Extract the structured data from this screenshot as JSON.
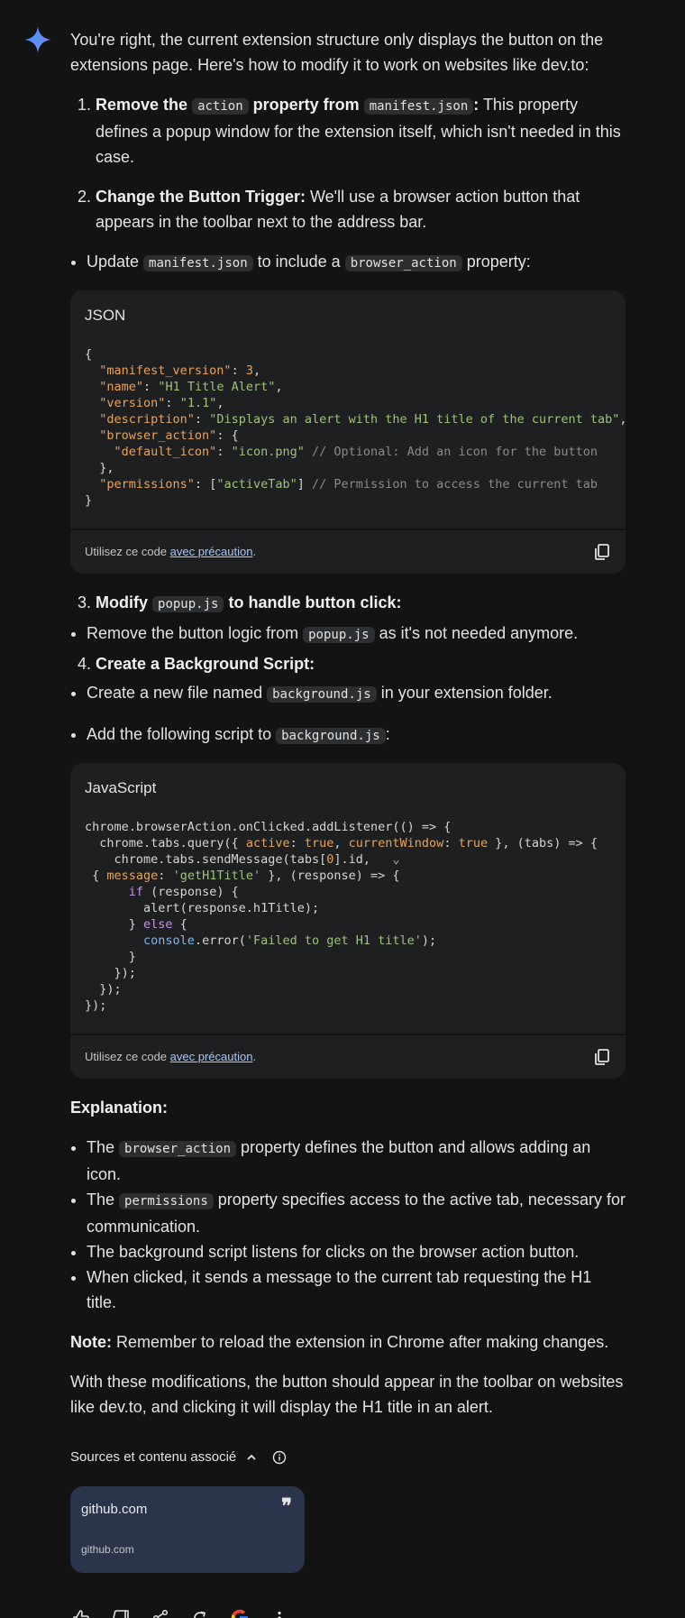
{
  "intro": "You're right, the current extension structure only displays the button on the extensions page. Here's how to modify it to work on websites like dev.to:",
  "step1": {
    "b1": "Remove the",
    "c1": "action",
    "b2": "property from",
    "c2": "manifest.json",
    "b3": ":",
    "text": " This property defines a popup window for the extension itself, which isn't needed in this case."
  },
  "step2": {
    "b": "Change the Button Trigger:",
    "text": " We'll use a browser action button that appears in the toolbar next to the address bar."
  },
  "bullet_update": {
    "t1": "Update ",
    "c1": "manifest.json",
    "t2": " to include a ",
    "c2": "browser_action",
    "t3": " property:"
  },
  "code1": {
    "lang": "JSON",
    "footer_text": "Utilisez ce code ",
    "footer_link": "avec précaution",
    "footer_end": "."
  },
  "step3": {
    "b1": "Modify",
    "c": "popup.js",
    "b2": "to handle button click:"
  },
  "bullet_remove": {
    "t1": "Remove the button logic from ",
    "c": "popup.js",
    "t2": " as it's not needed anymore."
  },
  "step4": {
    "b": "Create a Background Script:"
  },
  "bullet_create": {
    "t1": "Create a new file named ",
    "c": "background.js",
    "t2": " in your extension folder."
  },
  "bullet_add": {
    "t1": "Add the following script to ",
    "c": "background.js",
    "t2": ":"
  },
  "code2": {
    "lang": "JavaScript",
    "footer_text": "Utilisez ce code ",
    "footer_link": "avec précaution",
    "footer_end": "."
  },
  "explanation": {
    "title": "Explanation:",
    "items": [
      {
        "t1": "The ",
        "c": "browser_action",
        "t2": " property defines the button and allows adding an icon."
      },
      {
        "t1": "The ",
        "c": "permissions",
        "t2": " property specifies access to the active tab, necessary for communication."
      },
      {
        "t1": "The background script listens for clicks on the browser action button."
      },
      {
        "t1": "When clicked, it sends a message to the current tab requesting the H1 title."
      }
    ]
  },
  "note": {
    "b": "Note:",
    "text": " Remember to reload the extension in Chrome after making changes."
  },
  "outro": "With these modifications, the button should appear in the toolbar on websites like dev.to, and clicking it will display the H1 title in an alert.",
  "sources": {
    "label": "Sources et contenu associé"
  },
  "card": {
    "title": "github.com",
    "url": "github.com",
    "quote": "❞"
  },
  "colors": {
    "background": "#131314",
    "code_bg": "#1e1f20",
    "card_bg": "#2a344a",
    "link": "#a8c7fa"
  },
  "icons": [
    "gemini-spark-icon",
    "copy-icon",
    "chevron-up-icon",
    "info-icon",
    "thumbs-up-icon",
    "thumbs-down-icon",
    "share-icon",
    "regenerate-icon",
    "google-icon",
    "more-vert-icon"
  ]
}
